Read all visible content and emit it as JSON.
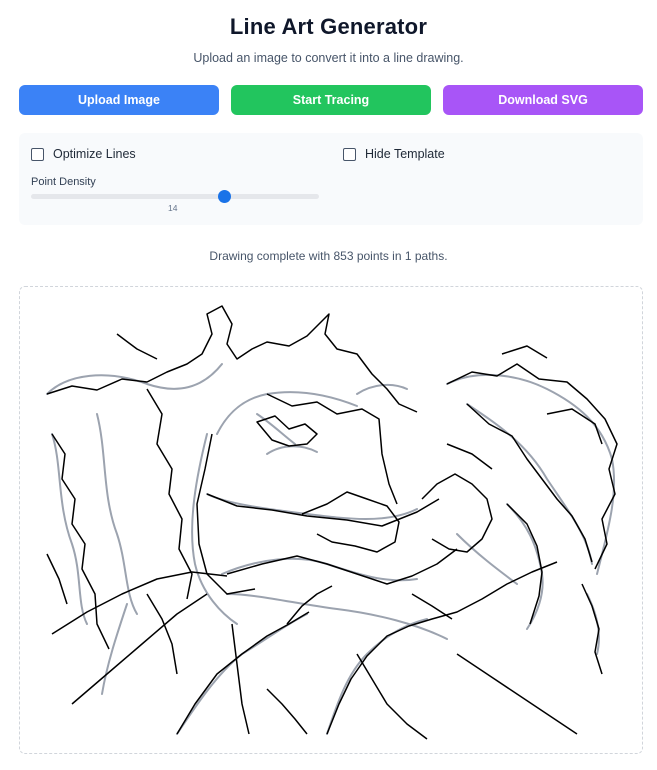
{
  "header": {
    "title": "Line Art Generator",
    "subtitle": "Upload an image to convert it into a line drawing."
  },
  "toolbar": {
    "upload_label": "Upload Image",
    "trace_label": "Start Tracing",
    "download_label": "Download SVG",
    "colors": {
      "upload": "#3b82f6",
      "trace": "#22c55e",
      "download": "#a855f7"
    }
  },
  "options": {
    "optimize_label": "Optimize Lines",
    "optimize_checked": false,
    "hide_template_label": "Hide Template",
    "hide_template_checked": false,
    "density_label": "Point Density",
    "density_value": "14",
    "density_fraction": 0.67
  },
  "status": {
    "message": "Drawing complete with 853 points in 1 paths."
  },
  "canvas": {
    "template_image": "horse-line-art",
    "trace_color": "#000000",
    "template_color": "#9ca3af"
  }
}
